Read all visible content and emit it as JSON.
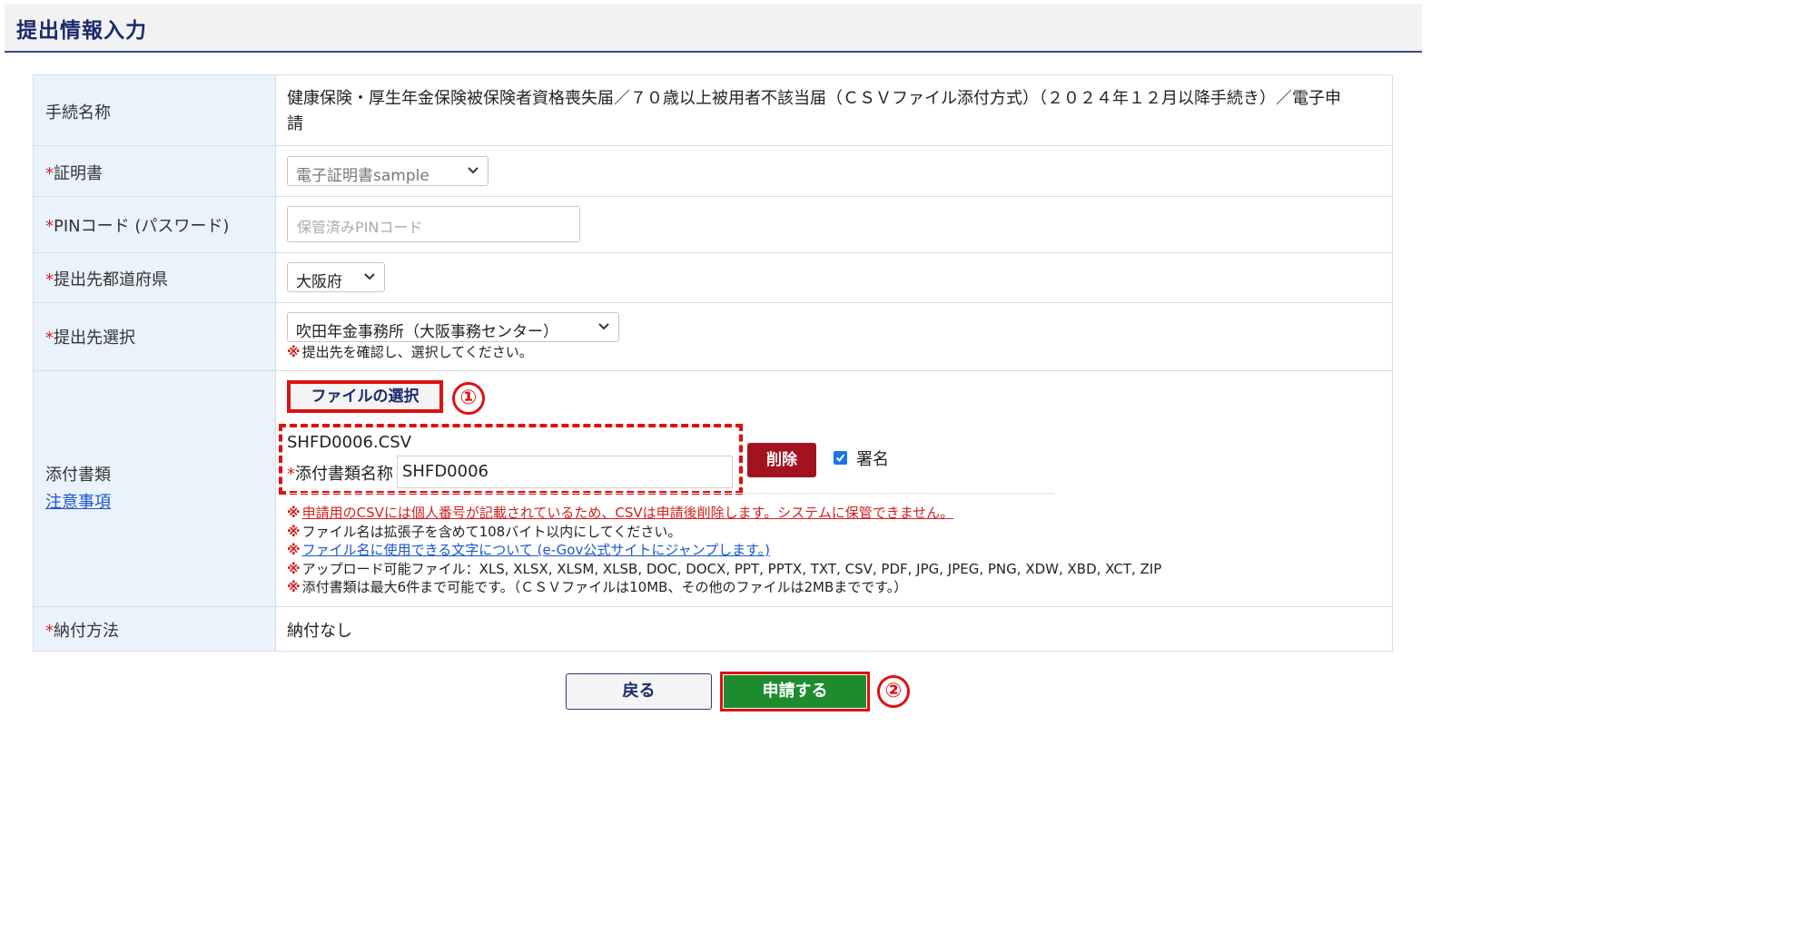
{
  "header": {
    "title": "提出情報入力"
  },
  "form": {
    "procedure": {
      "label": "手続名称",
      "value_line1": "健康保険・厚生年金保険被保険者資格喪失届／７０歳以上被用者不該当届（ＣＳＶファイル添付方式）（２０２４年１２月以降手続き）／電子申",
      "value_line2": "請"
    },
    "certificate": {
      "required_mark": "*",
      "label": "証明書",
      "selected": "電子証明書sample"
    },
    "pin": {
      "required_mark": "*",
      "label": "PINコード (パスワード)",
      "placeholder": "保管済みPINコード"
    },
    "prefecture": {
      "required_mark": "*",
      "label": "提出先都道府県",
      "selected": "大阪府"
    },
    "destination": {
      "required_mark": "*",
      "label": "提出先選択",
      "selected": "吹田年金事務所（大阪事務センター）",
      "note_mark": "※",
      "note": "提出先を確認し、選択してください。"
    },
    "attachments": {
      "label": "添付書類",
      "caution_link": "注意事項",
      "file_select_button": "ファイルの選択",
      "annotation_1": "①",
      "file_name": "SHFD0006.CSV",
      "doc_name_required_mark": "*",
      "doc_name_label": "添付書類名称",
      "doc_name_value": "SHFD0006",
      "delete_button": "削除",
      "sign_label": "署名",
      "sign_checked": true,
      "note_mark": "※",
      "notes": [
        "申請用のCSVには個人番号が記載されているため、CSVは申請後削除します。システムに保管できません。",
        "ファイル名は拡張子を含めて108バイト以内にしてください。",
        "ファイル名に使用できる文字について (e-Gov公式サイトにジャンプします。)",
        "アップロード可能ファイル：XLS, XLSX, XLSM, XLSB, DOC, DOCX, PPT, PPTX, TXT, CSV, PDF, JPG, JPEG, PNG, XDW, XBD, XCT, ZIP",
        "添付書類は最大6件まで可能です。（ＣＳＶファイルは10MB、その他のファイルは2MBまでです。）"
      ]
    },
    "payment": {
      "required_mark": "*",
      "label": "納付方法",
      "value": "納付なし"
    }
  },
  "actions": {
    "back_button": "戻る",
    "submit_button": "申請する",
    "annotation_2": "②"
  },
  "colors": {
    "header_title": "#1a2a6c",
    "label_bg": "#eaf2fb",
    "required": "#d42020",
    "annotation_red": "#e01010",
    "delete_bg": "#a3131f",
    "submit_bg": "#1e8c2e",
    "link_blue": "#1a55cc"
  },
  "icons": {
    "select_arrow": "chevron-down-icon",
    "checkbox": "checkmark-icon"
  }
}
